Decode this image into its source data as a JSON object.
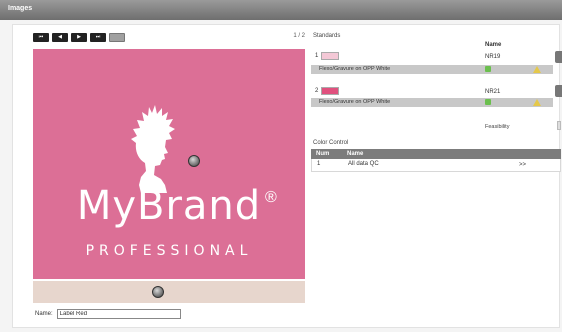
{
  "window": {
    "title": "Images"
  },
  "viewer": {
    "nav_buttons": [
      {
        "label": "⏮",
        "icon": "first-page-icon"
      },
      {
        "label": "◀",
        "icon": "prev-page-icon"
      },
      {
        "label": "▶",
        "icon": "next-page-icon"
      },
      {
        "label": "⏭",
        "icon": "last-page-icon"
      },
      {
        "label": "",
        "icon": "options-icon"
      }
    ],
    "pager": "1 / 2",
    "brand": {
      "name": "MyBrand",
      "registered": "®",
      "tagline": "PROFESSIONAL"
    },
    "preview_background": "#dc6f96",
    "name_label": "Name:",
    "name_value": "Label Red"
  },
  "standards": {
    "title": "Standards",
    "column_header": "Name",
    "items": [
      {
        "index": "1",
        "swatch_color": "#f4c8d6",
        "name": "NR19",
        "substrate": "Flexo/Gravure on OPP White"
      },
      {
        "index": "2",
        "swatch_color": "#e0517e",
        "name": "NR21",
        "substrate": "Flexo/Gravure on OPP White"
      }
    ],
    "feasibility_label": "Feasibility"
  },
  "color_control": {
    "title": "Color Control",
    "columns": [
      "Num",
      "Name"
    ],
    "rows": [
      {
        "num": "1",
        "name": "All data QC",
        "action": ">>"
      }
    ]
  }
}
